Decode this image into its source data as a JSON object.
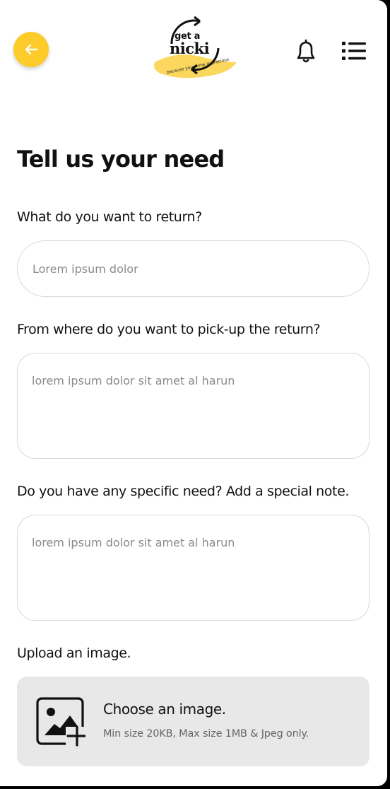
{
  "header": {
    "back_icon": "arrow-left-icon",
    "logo": {
      "line1": "get a",
      "line2": "nicki",
      "tagline": "because your time is precious"
    },
    "notification_icon": "bell-icon",
    "menu_icon": "list-menu-icon"
  },
  "colors": {
    "accent": "#FDCB2A",
    "text": "#111111",
    "placeholder": "#8A8A8A",
    "upload_bg": "#E8E8E8"
  },
  "form": {
    "title": "Tell us your need",
    "return_item": {
      "label": "What do you want to return?",
      "placeholder": "Lorem ipsum dolor"
    },
    "pickup_location": {
      "label": "From where do you want to pick-up the return?",
      "placeholder": "lorem ipsum dolor sit amet al harun"
    },
    "special_note": {
      "label": "Do you have any specific need? Add a special note.",
      "placeholder": "lorem ipsum dolor sit amet al harun"
    },
    "upload": {
      "label": "Upload an image.",
      "title": "Choose an image.",
      "hint": "Min size 20KB, Max size 1MB & Jpeg only.",
      "icon": "image-add-icon"
    }
  }
}
